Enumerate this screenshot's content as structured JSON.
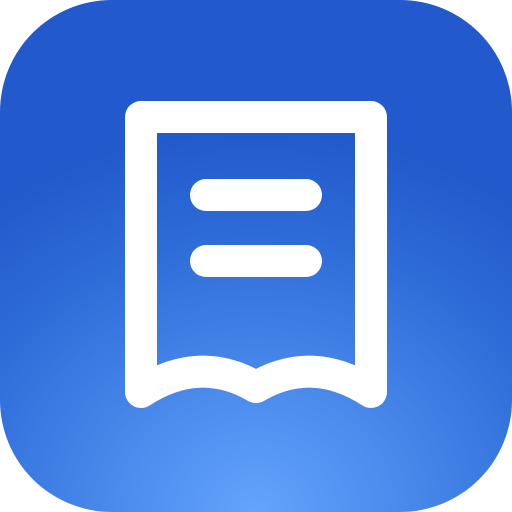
{
  "icon": {
    "glyph": "receipt-icon",
    "background_colors": {
      "top": "#2259cc",
      "middle": "#4585e8",
      "bottom_glow": "#63a4fd"
    },
    "foreground_color": "#ffffff"
  }
}
